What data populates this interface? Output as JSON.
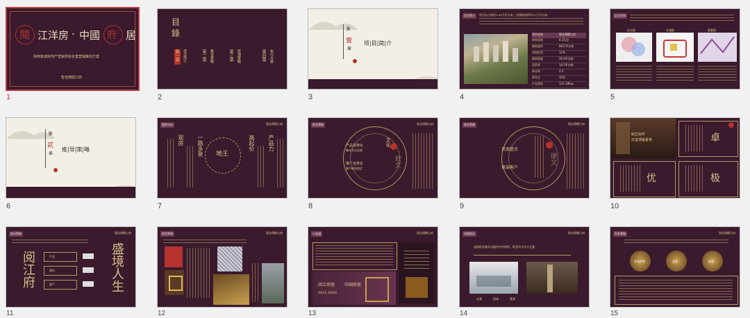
{
  "slides": [
    {
      "num": "1",
      "title_left": "閱",
      "title_main": "江洋房",
      "dot": "·",
      "title_main2": "中國",
      "title_right1": "府",
      "title_right2": "居",
      "subtitle": "陕西客城房地产营销项目全案营销策划方案",
      "brand": "智佳傳閱江府"
    },
    {
      "num": "2",
      "title": "目",
      "title2": "錄",
      "items": [
        {
          "v": "第一章",
          "label": "项目简介"
        },
        {
          "v": "第二章",
          "label": "推导策略"
        },
        {
          "v": "第三章",
          "label": "营销策略"
        },
        {
          "v": "第四章",
          "label": "执行方案"
        }
      ]
    },
    {
      "num": "3",
      "chapter_pre": "·第",
      "chapter_num": "壹",
      "chapter_post": "章",
      "title": "项|目|简|介"
    },
    {
      "num": "4",
      "tag": "项目简介",
      "desc": "项目总占地约3.43万平方米，总建筑面积约12万平方米。",
      "table_header": [
        "项目名称",
        "智佳傳閱江府"
      ],
      "rows": [
        [
          "规划用地",
          "6.3万亿"
        ],
        [
          "建筑面积",
          "66万平方米"
        ],
        [
          "用地性质",
          "11%"
        ],
        [
          "建筑密度",
          "20.5平方米"
        ],
        [
          "容积率",
          "14.5平方米"
        ],
        [
          "绿化率",
          "2.5"
        ],
        [
          "停车位",
          "35%"
        ],
        [
          "产品面积",
          "121-189㎡"
        ]
      ]
    },
    {
      "num": "5",
      "tag": "区位优势",
      "labels": [
        "区位图",
        "交通图",
        "配套图"
      ]
    },
    {
      "num": "6",
      "chapter_pre": "·第",
      "chapter_num": "贰",
      "chapter_post": "章",
      "title": "推|导|策|略"
    },
    {
      "num": "7",
      "tag": "客群分析",
      "center": "地王",
      "words": [
        "现房",
        "一路多景",
        "高起价",
        "产品力"
      ]
    },
    {
      "num": "8",
      "tag": "推导策略",
      "left": [
        "产品高档化",
        "整合专业资源",
        "推广造势化",
        "客户精准锁定"
      ],
      "center": "文化",
      "right": "软文",
      "brand": "智佳傳閱江府"
    },
    {
      "num": "9",
      "tag": "推导策略",
      "left": [
        "资源整合",
        "高端客户"
      ],
      "center": "硬文",
      "brand": "智佳傳閱江府"
    },
    {
      "num": "10",
      "tag1": "树立标杆",
      "tag2": "打造顶级豪宅",
      "chars": [
        "卓",
        "优",
        "极"
      ]
    },
    {
      "num": "11",
      "tag": "推导策略",
      "heading": "阅江府",
      "heading2": "盛境人生",
      "boxes": [
        "产品",
        "服务",
        "客户"
      ],
      "brand": "智佳傳閱江府"
    },
    {
      "num": "12",
      "tag": "推导策略",
      "brand": "智佳傳閱江府"
    },
    {
      "num": "13",
      "tag": "VI延展",
      "card_title": "阅江府居",
      "card_sub": "中国府居",
      "phone": "8855 8888",
      "brand": "智佳傳閱江府"
    },
    {
      "num": "14",
      "tag": "风格赋诉",
      "headline": "温润的灵魂文化融合中式规划，彰显中式东方之美",
      "photos": [
        "水景",
        "园林",
        "景观"
      ],
      "brand": "智佳傳閱江府"
    },
    {
      "num": "15",
      "tag": "色彩策略",
      "buttons": [
        "文化传承",
        "品质",
        "府居"
      ],
      "brand": "智佳傳閱江府"
    }
  ]
}
